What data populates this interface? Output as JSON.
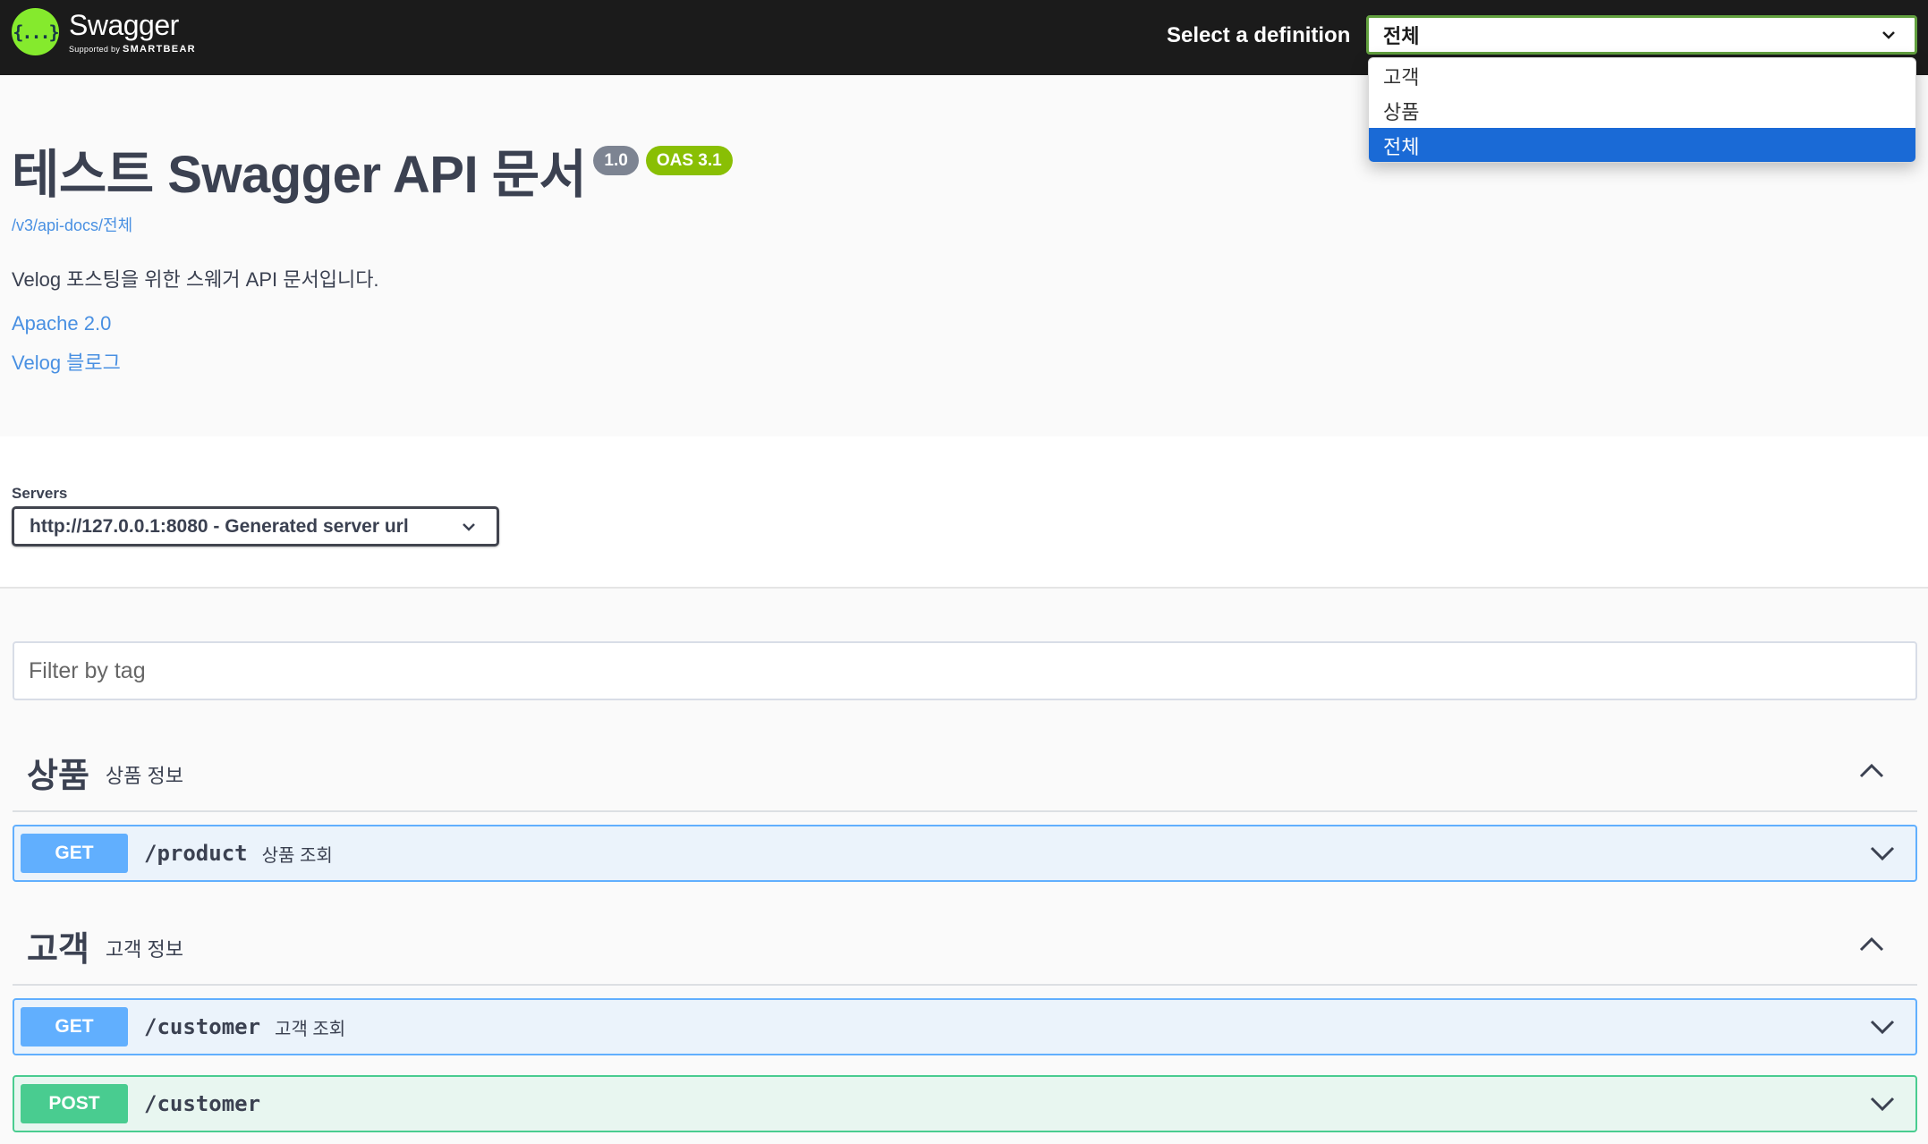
{
  "topbar": {
    "logo_mark": "{...}",
    "logo_name": "Swagger",
    "logo_sub_prefix": "Supported by",
    "logo_sub_brand": "SMARTBEAR",
    "definition_label": "Select a definition",
    "definition_value": "전체",
    "definition_options": [
      "고객",
      "상품",
      "전체"
    ]
  },
  "info": {
    "title": "테스트 Swagger API 문서",
    "version_badge": "1.0",
    "oas_badge": "OAS 3.1",
    "spec_url": "/v3/api-docs/전체",
    "description": "Velog 포스팅을 위한 스웨거 API 문서입니다.",
    "license_link": "Apache 2.0",
    "blog_link": "Velog 블로그"
  },
  "servers": {
    "label": "Servers",
    "selected": "http://127.0.0.1:8080 - Generated server url"
  },
  "filter": {
    "placeholder": "Filter by tag"
  },
  "tags": [
    {
      "name": "상품",
      "description": "상품 정보",
      "operations": [
        {
          "method": "GET",
          "path": "/product",
          "summary": "상품 조회"
        }
      ]
    },
    {
      "name": "고객",
      "description": "고객 정보",
      "operations": [
        {
          "method": "GET",
          "path": "/customer",
          "summary": "고객 조회"
        },
        {
          "method": "POST",
          "path": "/customer",
          "summary": ""
        }
      ]
    }
  ],
  "colors": {
    "topbar_bg": "#1b1b1b",
    "logo_green": "#85ea2d",
    "get_blue": "#61affe",
    "post_green": "#49cc90",
    "link_blue": "#4990e2",
    "dropdown_selected": "#1a6ad6"
  }
}
